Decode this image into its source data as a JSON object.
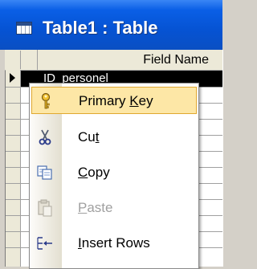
{
  "window": {
    "title": "Table1 : Table",
    "icon": "table-icon"
  },
  "grid": {
    "column_header": "Field Name",
    "selected_row_text": "ID_personel"
  },
  "context_menu": {
    "items": [
      {
        "label_pre": "Primary ",
        "label_key": "K",
        "label_post": "ey",
        "icon": "key-icon",
        "enabled": true,
        "highlighted": true
      },
      {
        "label_pre": "Cu",
        "label_key": "t",
        "label_post": "",
        "icon": "scissors-icon",
        "enabled": true,
        "highlighted": false
      },
      {
        "label_pre": "",
        "label_key": "C",
        "label_post": "opy",
        "icon": "copy-icon",
        "enabled": true,
        "highlighted": false
      },
      {
        "label_pre": "",
        "label_key": "P",
        "label_post": "aste",
        "icon": "paste-icon",
        "enabled": false,
        "highlighted": false
      },
      {
        "label_pre": "",
        "label_key": "I",
        "label_post": "nsert Rows",
        "icon": "insert-rows-icon",
        "enabled": true,
        "highlighted": false
      }
    ]
  }
}
